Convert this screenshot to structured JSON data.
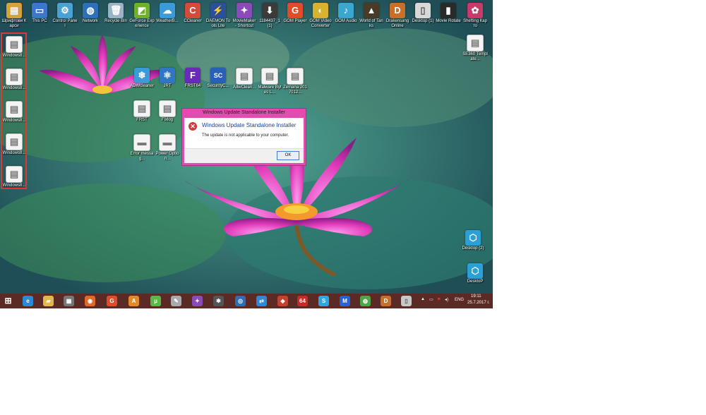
{
  "desktop": {
    "top_icons": [
      {
        "label": "Шрифтови Карси",
        "glyph": "▤",
        "color": "#d6a23a"
      },
      {
        "label": "This PC",
        "glyph": "▭",
        "color": "#3c77c9"
      },
      {
        "label": "Control Panel",
        "glyph": "⚙",
        "color": "#4aa1d4"
      },
      {
        "label": "Network",
        "glyph": "◍",
        "color": "#2e6fb9"
      },
      {
        "label": "Recycle Bin",
        "glyph": "🗑",
        "color": "#9ab3c5"
      },
      {
        "label": "GeForce Experience",
        "glyph": "◩",
        "color": "#6fb12a"
      },
      {
        "label": "WeatherB...",
        "glyph": "☁",
        "color": "#3a9bd8"
      },
      {
        "label": "CCleaner",
        "glyph": "C",
        "color": "#d34b3a"
      },
      {
        "label": "DAEMON Tools Lite",
        "glyph": "⚡",
        "color": "#2b4f9a"
      },
      {
        "label": "MovieMaker - Shortcut",
        "glyph": "✦",
        "color": "#8a4ab8"
      },
      {
        "label": "1184437_1 (1)",
        "glyph": "⬇",
        "color": "#3b3b3b"
      },
      {
        "label": "GOM Player",
        "glyph": "G",
        "color": "#e04c2a"
      },
      {
        "label": "GOM Video Converter",
        "glyph": "◐",
        "color": "#d8b330"
      },
      {
        "label": "GOM Audio",
        "glyph": "♪",
        "color": "#3aa7d0"
      },
      {
        "label": "World of Tanks",
        "glyph": "▲",
        "color": "#4a3a28"
      },
      {
        "label": "Drakensang Online",
        "glyph": "D",
        "color": "#c8702a"
      },
      {
        "label": "Desktop (1)",
        "glyph": "▯",
        "color": "#d8d8d8"
      },
      {
        "label": "Movie Rotate",
        "glyph": "▮",
        "color": "#2a2a2a"
      },
      {
        "label": "Shefting Карто",
        "glyph": "✿",
        "color": "#c83a6a"
      }
    ],
    "selected_icons": [
      {
        "label": "Windows8..."
      },
      {
        "label": "Windows8..."
      },
      {
        "label": "Windows8..."
      },
      {
        "label": "Windows8..."
      },
      {
        "label": "Windows8..."
      }
    ],
    "mid_icons": [
      {
        "label": "ADWcleaner",
        "glyph": "❄",
        "color": "#3a9bd8"
      },
      {
        "label": "JRT",
        "glyph": "⚛",
        "color": "#2f77c2"
      },
      {
        "label": "FRST64",
        "glyph": "F",
        "color": "#6a2ab8"
      },
      {
        "label": "SecurityC...",
        "glyph": "SC",
        "color": "#2a5fb8"
      },
      {
        "label": "AdwClean...",
        "glyph": "▤",
        "color": "file"
      },
      {
        "label": "Malware Bytes L...",
        "glyph": "▤",
        "color": "file"
      },
      {
        "label": "Zemana 2017012...",
        "glyph": "▤",
        "color": "file"
      },
      {
        "label": "FRST",
        "glyph": "▤",
        "color": "file"
      },
      {
        "label": "Fixlog",
        "glyph": "▤",
        "color": "file"
      },
      {
        "label": "Error messag...",
        "glyph": "▬",
        "color": "file"
      },
      {
        "label": "Power Option...",
        "glyph": "▬",
        "color": "file"
      }
    ],
    "right_icons": [
      {
        "label": "SE360 Template...",
        "glyph": "▤",
        "color": "file"
      },
      {
        "label": "Desktop (2)",
        "glyph": "⬡",
        "color": "#2a9fd8"
      },
      {
        "label": "DesktoP",
        "glyph": "⬡",
        "color": "#2a9fd8"
      }
    ]
  },
  "dialog": {
    "window_title": "Windows Update Standalone Installer",
    "heading": "Windows Update Standalone Installer",
    "message": "The update is not applicable to your computer.",
    "ok_label": "OK"
  },
  "taskbar": {
    "apps": [
      {
        "name": "start-button",
        "glyph": "⊞",
        "color": "#5b2a24"
      },
      {
        "name": "ie",
        "glyph": "e",
        "color": "#2a8ad8"
      },
      {
        "name": "explorer",
        "glyph": "▰",
        "color": "#e2b84a"
      },
      {
        "name": "media",
        "glyph": "▦",
        "color": "#777"
      },
      {
        "name": "firefox",
        "glyph": "◉",
        "color": "#e06a2a"
      },
      {
        "name": "gom",
        "glyph": "G",
        "color": "#e04c2a"
      },
      {
        "name": "avast",
        "glyph": "A",
        "color": "#e08a2a"
      },
      {
        "name": "utorrent",
        "glyph": "µ",
        "color": "#5ab84a"
      },
      {
        "name": "tool",
        "glyph": "✎",
        "color": "#aaa"
      },
      {
        "name": "movie",
        "glyph": "✦",
        "color": "#8a4ab8"
      },
      {
        "name": "tool2",
        "glyph": "✱",
        "color": "#555"
      },
      {
        "name": "app",
        "glyph": "◎",
        "color": "#2a6fb8"
      },
      {
        "name": "team",
        "glyph": "⇄",
        "color": "#2a8ad8"
      },
      {
        "name": "remote",
        "glyph": "◆",
        "color": "#c8402a"
      },
      {
        "name": "aida",
        "glyph": "64",
        "color": "#c82a2a"
      },
      {
        "name": "skype",
        "glyph": "S",
        "color": "#2aa8e0"
      },
      {
        "name": "malware",
        "glyph": "M",
        "color": "#2a5fd8"
      },
      {
        "name": "chrome",
        "glyph": "◍",
        "color": "#4aa84a"
      },
      {
        "name": "drakensang",
        "glyph": "D",
        "color": "#c8702a"
      },
      {
        "name": "window",
        "glyph": "▯",
        "color": "#c8c8c8"
      }
    ],
    "language": "ENG",
    "time": "19:11",
    "date": "25.7.2017 г."
  }
}
